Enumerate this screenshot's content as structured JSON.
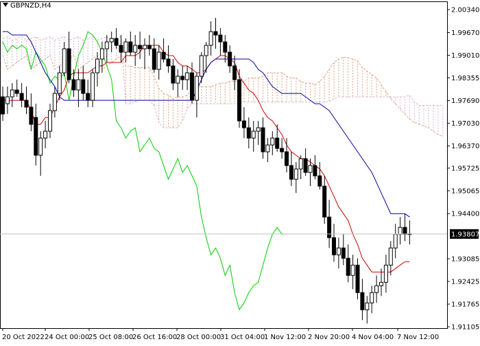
{
  "chart_data": {
    "type": "candlestick",
    "symbol_label": "GBPNZD,H4",
    "current_price": "1.93807",
    "y_tick_labels": [
      "2.00340",
      "1.99670",
      "1.99010",
      "1.98355",
      "1.97690",
      "1.97030",
      "1.96370",
      "1.95725",
      "1.95065",
      "1.94400",
      "1.93807",
      "1.93085",
      "1.92425",
      "1.91765",
      "1.91105"
    ],
    "y_tick_values": [
      2.0034,
      1.9967,
      1.9901,
      1.98355,
      1.9769,
      1.9703,
      1.9637,
      1.95725,
      1.95065,
      1.944,
      1.93807,
      1.93085,
      1.92425,
      1.91765,
      1.91105
    ],
    "ylim": [
      1.91105,
      2.0034
    ],
    "x_tick_labels": [
      "20 Oct 2022",
      "24 Oct 00:00",
      "25 Oct 08:00",
      "26 Oct 16:00",
      "28 Oct 00:00",
      "31 Oct 04:00",
      "1 Nov 12:00",
      "2 Nov 20:00",
      "4 Nov 04:00",
      "7 Nov 12:00"
    ],
    "x_tick_indices": [
      0,
      10,
      20,
      30,
      40,
      50,
      60,
      70,
      80,
      90
    ],
    "grid": false,
    "colors": {
      "candle": "#000000",
      "tenkan": "#cc0000",
      "kijun": "#000099",
      "chikou": "#00cc00",
      "senkou_a": "#e0a080",
      "senkou_b": "#d8b0d0",
      "price_line": "#c0c0c0"
    },
    "candles": [
      [
        1.978,
        1.981,
        1.971,
        1.973
      ],
      [
        1.976,
        1.981,
        1.973,
        1.978
      ],
      [
        1.978,
        1.982,
        1.975,
        1.98
      ],
      [
        1.98,
        1.983,
        1.978,
        1.979
      ],
      [
        1.979,
        1.982,
        1.975,
        1.977
      ],
      [
        1.977,
        1.981,
        1.973,
        1.975
      ],
      [
        1.975,
        1.979,
        1.968,
        1.97
      ],
      [
        1.972,
        1.976,
        1.958,
        1.961
      ],
      [
        1.961,
        1.968,
        1.955,
        1.966
      ],
      [
        1.966,
        1.971,
        1.963,
        1.968
      ],
      [
        1.968,
        1.976,
        1.966,
        1.974
      ],
      [
        1.974,
        1.981,
        1.972,
        1.979
      ],
      [
        1.979,
        1.987,
        1.977,
        1.985
      ],
      [
        1.985,
        1.994,
        1.984,
        1.992
      ],
      [
        1.992,
        1.997,
        1.982,
        1.983
      ],
      [
        1.983,
        1.986,
        1.978,
        1.98
      ],
      [
        1.98,
        1.986,
        1.975,
        1.983
      ],
      [
        1.983,
        1.987,
        1.977,
        1.979
      ],
      [
        1.979,
        1.983,
        1.975,
        1.977
      ],
      [
        1.977,
        1.986,
        1.975,
        1.985
      ],
      [
        1.985,
        1.991,
        1.981,
        1.989
      ],
      [
        1.989,
        1.994,
        1.985,
        1.992
      ],
      [
        1.992,
        1.996,
        1.988,
        1.994
      ],
      [
        1.994,
        1.997,
        1.991,
        1.995
      ],
      [
        1.995,
        1.998,
        1.992,
        1.993
      ],
      [
        1.993,
        1.996,
        1.988,
        1.991
      ],
      [
        1.991,
        1.995,
        1.988,
        1.994
      ],
      [
        1.994,
        1.997,
        1.99,
        1.991
      ],
      [
        1.991,
        1.996,
        1.987,
        1.993
      ],
      [
        1.993,
        1.997,
        1.989,
        1.992
      ],
      [
        1.992,
        1.995,
        1.986,
        1.993
      ],
      [
        1.993,
        1.996,
        1.99,
        1.992
      ],
      [
        1.992,
        1.995,
        1.985,
        1.986
      ],
      [
        1.986,
        1.993,
        1.983,
        1.991
      ],
      [
        1.991,
        1.995,
        1.988,
        1.989
      ],
      [
        1.989,
        1.993,
        1.985,
        1.987
      ],
      [
        1.987,
        1.989,
        1.98,
        1.982
      ],
      [
        1.982,
        1.986,
        1.978,
        1.984
      ],
      [
        1.984,
        1.987,
        1.98,
        1.983
      ],
      [
        1.983,
        1.987,
        1.98,
        1.985
      ],
      [
        1.985,
        1.988,
        1.976,
        1.977
      ],
      [
        1.977,
        1.985,
        1.972,
        1.984
      ],
      [
        1.984,
        1.991,
        1.982,
        1.99
      ],
      [
        1.99,
        1.994,
        1.985,
        1.993
      ],
      [
        1.993,
        2.0,
        1.99,
        1.997
      ],
      [
        1.997,
        2.001,
        1.992,
        1.996
      ],
      [
        1.996,
        1.998,
        1.99,
        1.994
      ],
      [
        1.994,
        1.996,
        1.988,
        1.991
      ],
      [
        1.991,
        1.993,
        1.985,
        1.987
      ],
      [
        1.987,
        1.99,
        1.98,
        1.983
      ],
      [
        1.983,
        1.986,
        1.969,
        1.971
      ],
      [
        1.971,
        1.975,
        1.966,
        1.969
      ],
      [
        1.969,
        1.972,
        1.963,
        1.966
      ],
      [
        1.966,
        1.971,
        1.962,
        1.968
      ],
      [
        1.968,
        1.971,
        1.964,
        1.969
      ],
      [
        1.969,
        1.972,
        1.96,
        1.962
      ],
      [
        1.962,
        1.966,
        1.959,
        1.964
      ],
      [
        1.964,
        1.968,
        1.961,
        1.966
      ],
      [
        1.966,
        1.97,
        1.962,
        1.963
      ],
      [
        1.963,
        1.966,
        1.96,
        1.962
      ],
      [
        1.962,
        1.966,
        1.956,
        1.958
      ],
      [
        1.958,
        1.962,
        1.952,
        1.954
      ],
      [
        1.954,
        1.959,
        1.95,
        1.957
      ],
      [
        1.957,
        1.961,
        1.954,
        1.96
      ],
      [
        1.96,
        1.963,
        1.955,
        1.956
      ],
      [
        1.956,
        1.96,
        1.952,
        1.958
      ],
      [
        1.958,
        1.961,
        1.954,
        1.955
      ],
      [
        1.955,
        1.959,
        1.951,
        1.952
      ],
      [
        1.952,
        1.955,
        1.941,
        1.943
      ],
      [
        1.943,
        1.948,
        1.934,
        1.937
      ],
      [
        1.937,
        1.941,
        1.93,
        1.932
      ],
      [
        1.932,
        1.937,
        1.928,
        1.934
      ],
      [
        1.934,
        1.938,
        1.929,
        1.931
      ],
      [
        1.931,
        1.935,
        1.924,
        1.926
      ],
      [
        1.926,
        1.932,
        1.922,
        1.929
      ],
      [
        1.929,
        1.931,
        1.919,
        1.921
      ],
      [
        1.921,
        1.925,
        1.913,
        1.916
      ],
      [
        1.916,
        1.92,
        1.912,
        1.918
      ],
      [
        1.918,
        1.923,
        1.915,
        1.921
      ],
      [
        1.921,
        1.926,
        1.918,
        1.923
      ],
      [
        1.923,
        1.928,
        1.92,
        1.924
      ],
      [
        1.924,
        1.932,
        1.921,
        1.929
      ],
      [
        1.929,
        1.936,
        1.926,
        1.934
      ],
      [
        1.934,
        1.941,
        1.931,
        1.938
      ],
      [
        1.938,
        1.943,
        1.935,
        1.94
      ],
      [
        1.94,
        1.944,
        1.936,
        1.938
      ],
      [
        1.938,
        1.942,
        1.935,
        1.9381
      ]
    ],
    "tenkan": [
      1.977,
      1.977,
      1.977,
      1.977,
      1.977,
      1.977,
      1.974,
      1.97,
      1.97,
      1.972,
      1.972,
      1.975,
      1.978,
      1.98,
      1.984,
      1.985,
      1.985,
      1.985,
      1.985,
      1.986,
      1.987,
      1.987,
      1.988,
      1.988,
      1.988,
      1.988,
      1.99,
      1.99,
      1.99,
      1.991,
      1.993,
      1.993,
      1.993,
      1.993,
      1.991,
      1.99,
      1.99,
      1.988,
      1.987,
      1.987,
      1.986,
      1.985,
      1.985,
      1.986,
      1.988,
      1.989,
      1.99,
      1.99,
      1.989,
      1.988,
      1.984,
      1.982,
      1.98,
      1.979,
      1.977,
      1.974,
      1.972,
      1.971,
      1.969,
      1.967,
      1.964,
      1.962,
      1.961,
      1.96,
      1.96,
      1.959,
      1.958,
      1.957,
      1.955,
      1.952,
      1.949,
      1.946,
      1.944,
      1.942,
      1.938,
      1.935,
      1.931,
      1.929,
      1.927,
      1.927,
      1.927,
      1.927,
      1.927,
      1.928,
      1.929,
      1.93,
      1.93
    ],
    "kijun": [
      1.997,
      1.997,
      1.996,
      1.996,
      1.996,
      1.996,
      1.994,
      1.991,
      1.988,
      1.985,
      1.983,
      1.981,
      1.978,
      1.977,
      1.977,
      1.977,
      1.977,
      1.977,
      1.977,
      1.977,
      1.977,
      1.977,
      1.977,
      1.977,
      1.977,
      1.977,
      1.977,
      1.977,
      1.977,
      1.977,
      1.977,
      1.977,
      1.977,
      1.977,
      1.977,
      1.977,
      1.977,
      1.977,
      1.977,
      1.977,
      1.977,
      1.98,
      1.983,
      1.986,
      1.988,
      1.989,
      1.989,
      1.989,
      1.989,
      1.989,
      1.989,
      1.989,
      1.989,
      1.988,
      1.986,
      1.985,
      1.983,
      1.981,
      1.98,
      1.979,
      1.979,
      1.979,
      1.979,
      1.979,
      1.978,
      1.977,
      1.976,
      1.976,
      1.975,
      1.974,
      1.972,
      1.97,
      1.968,
      1.966,
      1.964,
      1.962,
      1.96,
      1.958,
      1.956,
      1.953,
      1.95,
      1.947,
      1.944,
      1.944,
      1.944,
      1.944,
      1.943
    ]
  }
}
